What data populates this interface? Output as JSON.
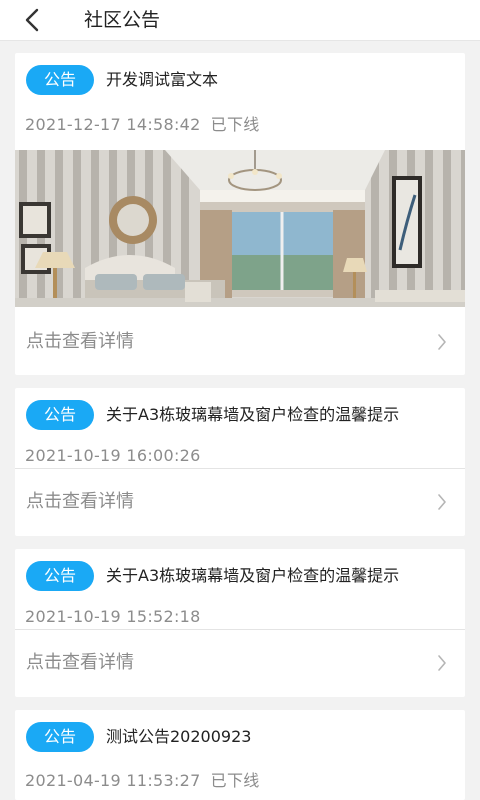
{
  "header": {
    "title": "社区公告"
  },
  "notices": [
    {
      "badge": "公告",
      "title": "开发调试富文本",
      "datetime": "2021-12-17 14:58:42",
      "status": "已下线",
      "detail_label": "点击查看详情"
    },
    {
      "badge": "公告",
      "title": "关于A3栋玻璃幕墙及窗户检查的温馨提示",
      "datetime": "2021-10-19 16:00:26",
      "status": "",
      "detail_label": "点击查看详情"
    },
    {
      "badge": "公告",
      "title": "关于A3栋玻璃幕墙及窗户检查的温馨提示",
      "datetime": "2021-10-19 15:52:18",
      "status": "",
      "detail_label": "点击查看详情"
    },
    {
      "badge": "公告",
      "title": "测试公告20200923",
      "datetime": "2021-04-19 11:53:27",
      "status": "已下线",
      "detail_label": ""
    }
  ],
  "colors": {
    "accent": "#1aa9f5",
    "background": "#f2f2f2",
    "meta_text": "#8c8c8c"
  },
  "icons": {
    "back": "chevron-left-icon",
    "detail_arrow": "chevron-right-icon"
  }
}
